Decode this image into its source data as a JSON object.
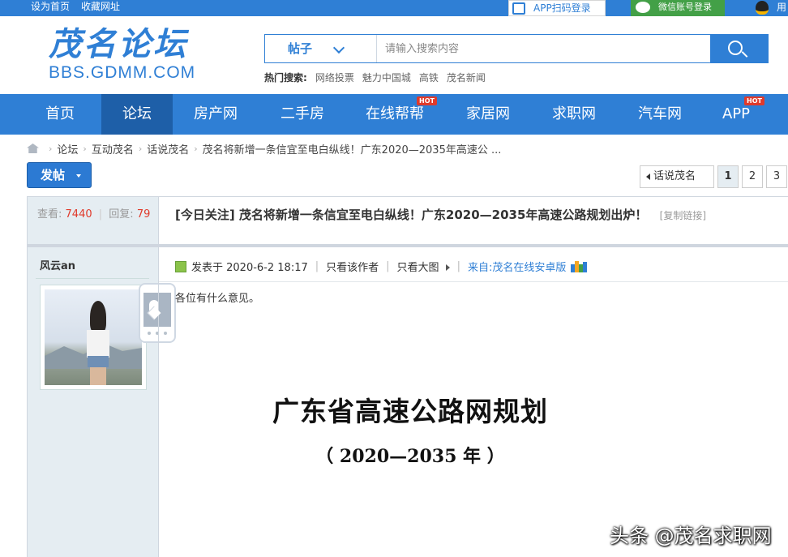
{
  "topbar": {
    "set_home": "设为首页",
    "bookmark": "收藏网址",
    "app_login": "APP扫码登录",
    "wechat_login": "微信账号登录",
    "qq_login": "用"
  },
  "header": {
    "logo_cn": "茂名论坛",
    "logo_en": "BBS.GDMM.COM",
    "search_type": "帖子",
    "search_placeholder": "请输入搜索内容",
    "hot_label": "热门搜索:",
    "hot_terms": [
      "网络投票",
      "魅力中国城",
      "高铁",
      "茂名新闻"
    ]
  },
  "nav": {
    "items": [
      {
        "label": "首页"
      },
      {
        "label": "论坛"
      },
      {
        "label": "房产网"
      },
      {
        "label": "二手房"
      },
      {
        "label": "在线帮帮"
      },
      {
        "label": "家居网"
      },
      {
        "label": "求职网"
      },
      {
        "label": "汽车网"
      },
      {
        "label": "APP"
      }
    ],
    "hot_badge": "HOT"
  },
  "breadcrumb": [
    "论坛",
    "互动茂名",
    "话说茂名",
    "茂名将新增一条信宜至电白纵线！广东2020—2035年高速公 ..."
  ],
  "toolbar": {
    "post_button": "发帖",
    "back_label": "话说茂名",
    "pages": [
      "1",
      "2",
      "3"
    ]
  },
  "thread": {
    "views_label": "查看:",
    "views": "7440",
    "replies_label": "回复:",
    "replies": "79",
    "title": "[今日关注] 茂名将新增一条信宜至电白纵线！广东2020—2035年高速公路规划出炉！",
    "copy_link": "[复制链接]",
    "author": "风云an",
    "posted_at": "发表于 2020-6-2 18:17",
    "only_author": "只看该作者",
    "big_images": "只看大图",
    "source": "来自:茂名在线安卓版",
    "body": "各位有什么意见。",
    "doc_title": "广东省高速公路网规划",
    "doc_subtitle": "（ 2020—2035 年 ）"
  },
  "watermark": "头条 @茂名求职网",
  "colors": {
    "brand_blue": "#2f7fd5",
    "nav_active": "#1e5fa8",
    "hot_red": "#e03a2b"
  }
}
